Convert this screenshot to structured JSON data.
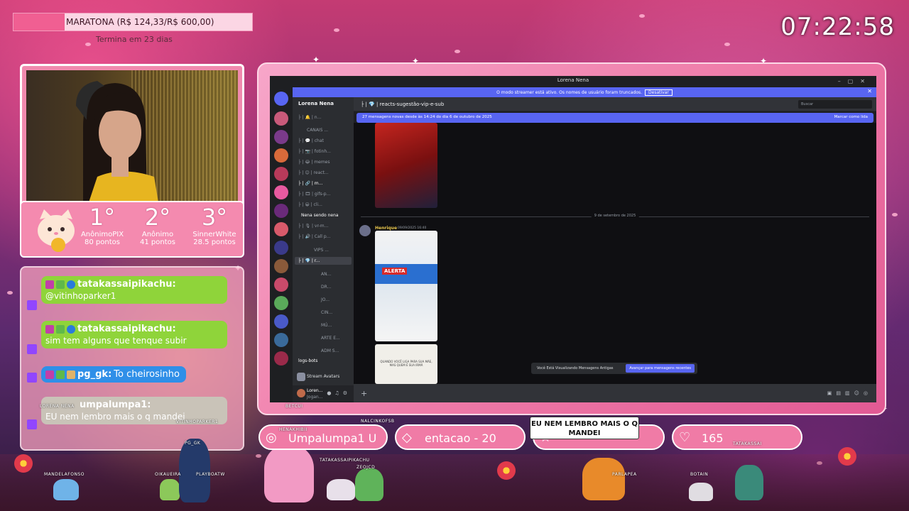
{
  "overlay": {
    "goal": {
      "label": "MARATONA (R$ 124,33/R$ 600,00)",
      "subtitle": "Termina em 23 dias",
      "progress": 0.2072
    },
    "clock": "07:22:58",
    "podium": [
      {
        "place": "1°",
        "name": "AnônimoPIX",
        "points": "80 pontos"
      },
      {
        "place": "2°",
        "name": "Anônimo",
        "points": "41 pontos"
      },
      {
        "place": "3°",
        "name": "SinnerWhite",
        "points": "28.5 pontos"
      }
    ],
    "chat": [
      {
        "user": "tatakassaipikachu:",
        "text": "@vitinhoparker1",
        "color": "#8fd43a"
      },
      {
        "user": "tatakassaipikachu:",
        "text": "sim tem alguns que tenque subir",
        "color": "#8fd43a"
      },
      {
        "user": "pg_gk:",
        "text": "To cheirosinho",
        "color": "#2f8fe8"
      },
      {
        "user": "umpalumpa1:",
        "text": "EU nem lembro mais o q mandei",
        "color": "#c9c3b8"
      }
    ],
    "alerts": {
      "follow": "Umpalumpa1  U",
      "gem": "entacao - 20",
      "hearts": "165",
      "speech": "EU NEM LEMBRO MAIS O Q MANDEI"
    },
    "nicknames": [
      "LORENA NENA",
      "MANDELAFONSO",
      "OIKAUEIRA",
      "PLAYBOATW",
      "VITINHOPARKER1",
      "HENAKHIBII",
      "NALCINKOFSB",
      "TATAKASSAIPIKACHU",
      "ZEOJCD",
      "PG_GK",
      "PARLAPEA",
      "BOTAIN",
      "TATAKASSAI",
      "BETCUI"
    ]
  },
  "discord": {
    "window_title": "Lorena Nena",
    "streamer_notice": "O modo streamer está ativo. Os nomes de usuário foram truncados.",
    "streamer_button": "Desativar",
    "server_name": "Lorena Nena",
    "channels": [
      "├ | 🔔 | n...",
      "CANAIS ...",
      "├ | 💬 | chat",
      "├ | 📷 | fotinh...",
      "├ | 😂 | memes",
      "├ | 😊 | react...",
      "├ | 🔗 | m...",
      "├ | 🎞 | gifs-p...",
      "├ | 😀 | cli...",
      "Nena sendo nena",
      "├ | 🎙 | vr-m...",
      "├ | 🔊 | Call p...",
      "VIPS ...",
      "├ | 💎 | r...",
      "AN...",
      "DR...",
      "JO...",
      "CIN...",
      "MÚ...",
      "ARTE E...",
      "ADM S...",
      "logs-bots"
    ],
    "channel_header": "├ | 💎 | reacts-sugestão-vip-e-sub",
    "search_placeholder": "Buscar",
    "new_messages": "27 mensagens novas desde às 14:24 do dia 6 de outubro de 2025",
    "mark_read": "Marcar como lida",
    "date_divider": "9 de setembro de 2025",
    "author": "Henrique",
    "author_time": "09/09/2025 16:40",
    "video_caption": "ALERTA",
    "meme_caption": "QUANDO VOCÊ LIGA PARA SUA MÃE, MAS QUEM É SUA IRMÃ",
    "old_messages": "Você Está Visualizando Mensagens Antigas",
    "jump_button": "Avançar para mensagens recentes",
    "stream_avatars": "Stream Avatars",
    "user": "Loren...",
    "user_status": "Jogan..."
  }
}
